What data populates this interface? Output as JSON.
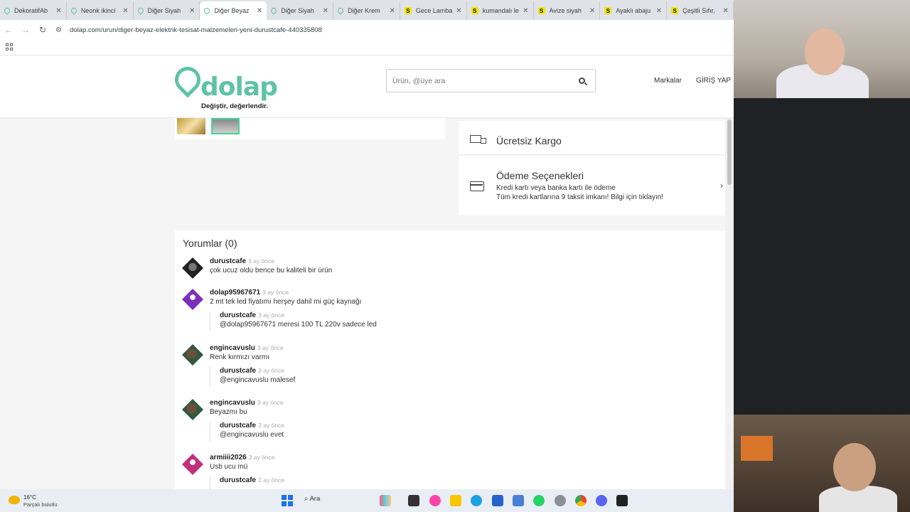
{
  "tabs": [
    {
      "title": "DekoratifAb",
      "icon": "dolap-icon",
      "active": false
    },
    {
      "title": "Neonk ikinci",
      "icon": "dolap-icon",
      "active": false
    },
    {
      "title": "Diğer Siyah",
      "icon": "dolap-icon",
      "active": false
    },
    {
      "title": "Diğer Beyaz",
      "icon": "dolap-icon",
      "active": true
    },
    {
      "title": "Diğer Siyah",
      "icon": "dolap-icon",
      "active": false
    },
    {
      "title": "Diğer Krem",
      "icon": "dolap-icon",
      "active": false
    },
    {
      "title": "Gece Lamba",
      "icon": "s-icon",
      "active": false
    },
    {
      "title": "kumandalı le",
      "icon": "s-icon",
      "active": false
    },
    {
      "title": "Avize siyah",
      "icon": "s-icon",
      "active": false
    },
    {
      "title": "Ayaklı abaju",
      "icon": "s-icon",
      "active": false
    },
    {
      "title": "Çeşitli Sıfır,",
      "icon": "s-icon",
      "active": false
    }
  ],
  "address_bar": {
    "url": "dolap.com/urun/diger-beyaz-elektrik-tesisat-malzemeleri-yeni-durustcafe-440335808"
  },
  "header": {
    "logo_text": "dolap",
    "logo_tagline": "Değiştir, değerlendir.",
    "search_placeholder": "Ürün, @üye ara",
    "nav_brands": "Markalar",
    "nav_login": "GİRİŞ YAP",
    "brand_color": "#5fc3a5"
  },
  "info": {
    "shipping_title": "Ücretsiz Kargo",
    "payment_title": "Ödeme Seçenekleri",
    "payment_line1": "Kredi kartı veya banka kartı ile ödeme",
    "payment_line2": "Tüm kredi kartlarına 9 taksit imkanı! Bilgi için tıklayın!"
  },
  "comments": {
    "title": "Yorumlar (0)",
    "items": [
      {
        "user": "durustcafe",
        "time": "3 ay önce",
        "text": "çok ucuz oldu bence bu kaliteli bir ürün",
        "avatar": "dark"
      },
      {
        "user": "dolap95967671",
        "time": "3 ay önce",
        "text": "2 mt tek led fiyatımı herşey dahil mi güç kaynağı",
        "avatar": "purple",
        "reply": {
          "user": "durustcafe",
          "time": "3 ay önce",
          "text": "@dolap95967671 meresi 100 TL 220v sadece led"
        }
      },
      {
        "user": "engincavuslu",
        "time": "3 ay önce",
        "text": "Renk kırmızı varmı",
        "avatar": "green",
        "reply": {
          "user": "durustcafe",
          "time": "3 ay önce",
          "text": "@engincavuslu malesef"
        }
      },
      {
        "user": "engincavuslu",
        "time": "3 ay önce",
        "text": "Beyazmı bu",
        "avatar": "green",
        "reply": {
          "user": "durustcafe",
          "time": "3 ay önce",
          "text": "@engincavuslu evet"
        }
      },
      {
        "user": "armiiii2026",
        "time": "3 ay önce",
        "text": "Usb ucu mü",
        "avatar": "pink",
        "reply": {
          "user": "durustcafe",
          "time": "2 ay önce",
          "text": ""
        }
      }
    ]
  },
  "taskbar": {
    "temp": "16°C",
    "weather": "Parçalı bulutlu",
    "search_label": "Ara"
  }
}
